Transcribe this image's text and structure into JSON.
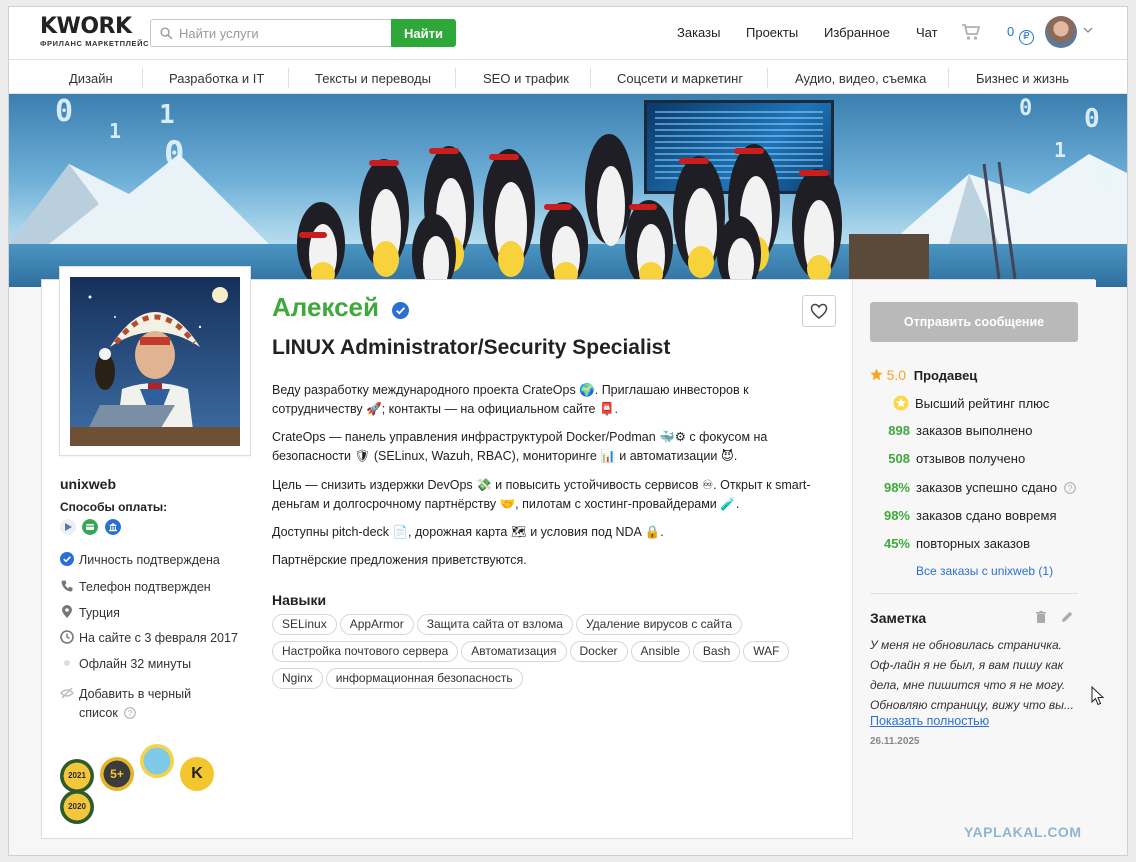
{
  "brand": {
    "name": "KWORK",
    "tagline": "ФРИЛАНС МАРКЕТПЛЕЙС"
  },
  "search": {
    "placeholder": "Найти услуги",
    "button": "Найти"
  },
  "nav": {
    "orders": "Заказы",
    "projects": "Проекты",
    "favorites": "Избранное",
    "chat": "Чат",
    "balance": "0",
    "currency": "₽"
  },
  "categories": [
    "Дизайн",
    "Разработка и IT",
    "Тексты и переводы",
    "SEO и трафик",
    "Соцсети и маркетинг",
    "Аудио, видео, съемка",
    "Бизнес и жизнь"
  ],
  "banner_digits": [
    "0",
    "1",
    "0",
    "1",
    "0",
    "0",
    "1",
    "0"
  ],
  "profile": {
    "username": "unixweb",
    "payment_label": "Способы оплаты:",
    "identity": "Личность подтверждена",
    "phone": "Телефон подтвержден",
    "country": "Турция",
    "since": "На сайте с 3 февраля 2017",
    "online": "Офлайн 32 минуты",
    "blacklist_1": "Добавить в черный",
    "blacklist_2": "список",
    "badges": [
      "2021",
      "5+",
      "",
      "K",
      "2020"
    ]
  },
  "main": {
    "name": "Алексей",
    "title": "LINUX Administrator/Security Specialist",
    "paragraphs": [
      "Веду разработку международного проекта CrateOps 🌍. Приглашаю инвесторов к сотрудничеству 🚀; контакты — на официальном сайте 📮.",
      "CrateOps — панель управления инфраструктурой Docker/Podman 🐳⚙ с фокусом на безопасности 🛡 (SELinux, Wazuh, RBAC), мониторинге 📊 и автоматизации 😈.",
      "Цель — снизить издержки DevOps 💸 и повысить устойчивость сервисов ♾. Открыт к smart-деньгам и долгосрочному партнёрству 🤝, пилотам с хостинг-провайдерами 🧪.",
      "Доступны pitch-deck 📄, дорожная карта 🗺 и условия под NDA 🔒.",
      "Партнёрские предложения приветствуются."
    ],
    "skills_title": "Навыки",
    "skills": [
      "SELinux",
      "AppArmor",
      "Защита сайта от взлома",
      "Удаление вирусов с сайта",
      "Настройка почтового сервера",
      "Автоматизация",
      "Docker",
      "Ansible",
      "Bash",
      "WAF",
      "Nginx",
      "информационная безопасность"
    ]
  },
  "sidebar": {
    "message_button": "Отправить сообщение",
    "rating": "5.0",
    "rating_label": "Продавец",
    "top_rating": "Высший рейтинг плюс",
    "stats": [
      {
        "value": "898",
        "label": "заказов выполнено"
      },
      {
        "value": "508",
        "label": "отзывов получено"
      },
      {
        "value": "98%",
        "label": "заказов успешно сдано"
      },
      {
        "value": "98%",
        "label": "заказов сдано вовремя"
      },
      {
        "value": "45%",
        "label": "повторных заказов"
      }
    ],
    "all_orders": "Все заказы с unixweb (1)",
    "note_title": "Заметка",
    "note_lines": [
      "У меня не обновилась страничка.",
      "Оф-лайн я не был, я вам пишу как",
      "дела, мне пишится что я не могу.",
      "Обновляю страницу, вижу что вы..."
    ],
    "note_more": "Показать полностью",
    "note_date": "26.11.2025"
  },
  "watermark": "YAPLAKAL.COM",
  "colors": {
    "accent": "#3fa93b",
    "link": "#2a6fd6",
    "search_button": "#2fa83a",
    "message_button_disabled": "#b9b9b9"
  }
}
